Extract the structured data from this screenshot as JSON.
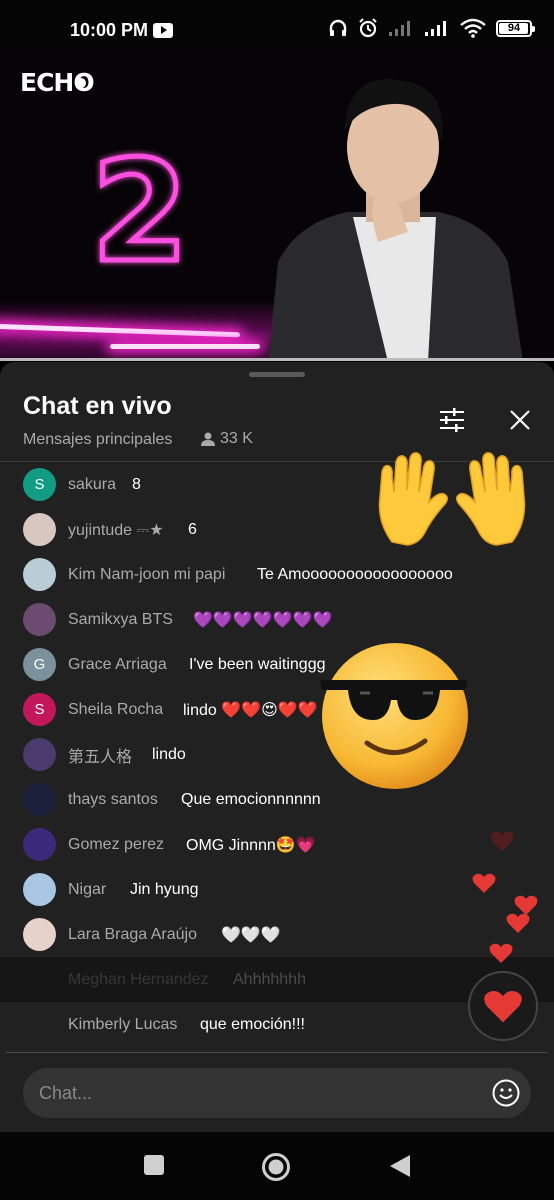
{
  "status_bar": {
    "time": "10:00 PM",
    "battery": "94"
  },
  "video": {
    "logo": "ECHO",
    "neon_number": "2"
  },
  "chat": {
    "title": "Chat en vivo",
    "subtitle": "Mensajes principales",
    "viewer_count": "33 K",
    "input_placeholder": "Chat...",
    "messages": [
      {
        "author": "sakura",
        "text": "8",
        "avatar_letter": "S",
        "avatar_color": "#129c84"
      },
      {
        "author": "yujintude ⎓★",
        "text": "6",
        "avatar_letter": "",
        "avatar_color": "#d8c6c0"
      },
      {
        "author": "Kim Nam-joon mi papi",
        "text": "Te Amooooooooooooooooo",
        "avatar_letter": "",
        "avatar_color": "#b9cdd6"
      },
      {
        "author": "Samikxya BTS",
        "text": "💜💜💜💜💜💜💜",
        "avatar_letter": "",
        "avatar_color": "#6b4b6f"
      },
      {
        "author": "Grace Arriaga",
        "text": "I've been waitinggg",
        "avatar_letter": "G",
        "avatar_color": "#7b919c"
      },
      {
        "author": "Sheila Rocha",
        "text": "lindo ❤️❤️😍❤️❤️",
        "avatar_letter": "S",
        "avatar_color": "#c2185b"
      },
      {
        "author": "第五人格",
        "text": "lindo",
        "avatar_letter": "",
        "avatar_color": "#4a3a6e"
      },
      {
        "author": "thays santos",
        "text": "Que emocionnnnnn",
        "avatar_letter": "",
        "avatar_color": "#1b1f3a"
      },
      {
        "author": "Gomez perez",
        "text": "OMG Jinnnn🤩💗",
        "avatar_letter": "",
        "avatar_color": "#3b2a7a"
      },
      {
        "author": "Nigar",
        "text": "Jin hyung",
        "avatar_letter": "",
        "avatar_color": "#a9c6e2"
      },
      {
        "author": "Lara Braga Araújo",
        "text": "🤍🤍🤍",
        "avatar_letter": "",
        "avatar_color": "#e6d2c8"
      },
      {
        "author": "Meghan Hernandez",
        "text": "Ahhhhhhh",
        "avatar_letter": "",
        "avatar_color": "#333333"
      },
      {
        "author": "Kimberly Lucas",
        "text": "que emoción!!!",
        "avatar_letter": "",
        "avatar_color": "#212121"
      }
    ]
  },
  "reactions": [
    "raised-hands",
    "sunglasses-face",
    "hearts"
  ],
  "colors": {
    "panel": "#212121",
    "accent_pink": "#ff29d4",
    "heart": "#e53935"
  }
}
